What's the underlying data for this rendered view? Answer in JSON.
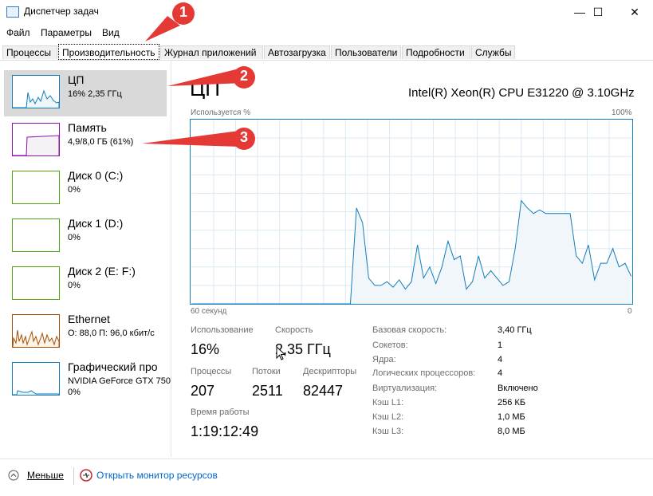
{
  "window": {
    "title": "Диспетчер задач",
    "controls": {
      "minimize": "—",
      "maximize": "☐",
      "close": "✕"
    }
  },
  "menu": [
    "Файл",
    "Параметры",
    "Вид"
  ],
  "tabs": [
    "Процессы",
    "Производительность",
    "Журнал приложений",
    "Автозагрузка",
    "Пользователи",
    "Подробности",
    "Службы"
  ],
  "active_tab": "Производительность",
  "sidebar": {
    "items": [
      {
        "name": "ЦП",
        "sub": "16% 2,35 ГГц",
        "color": "#117dbb",
        "selected": true
      },
      {
        "name": "Память",
        "sub": "4,9/8,0 ГБ (61%)",
        "color": "#8b12ae",
        "selected": false
      },
      {
        "name": "Диск 0 (C:)",
        "sub": "0%",
        "color": "#4da60c",
        "selected": false
      },
      {
        "name": "Диск 1 (D:)",
        "sub": "0%",
        "color": "#4da60c",
        "selected": false
      },
      {
        "name": "Диск 2 (E: F:)",
        "sub": "0%",
        "color": "#4da60c",
        "selected": false
      },
      {
        "name": "Ethernet",
        "sub": "О: 88,0 П: 96,0 кбит/с",
        "color": "#a74f01",
        "selected": false
      },
      {
        "name": "Графический про",
        "sub": "NVIDIA GeForce GTX 750",
        "sub2": "0%",
        "color": "#117dbb",
        "selected": false
      }
    ]
  },
  "main": {
    "title": "ЦП",
    "cpu_name": "Intel(R) Xeon(R) CPU E31220 @ 3.10GHz",
    "graph_top_left": "Используется %",
    "graph_top_right": "100%",
    "graph_bottom_left": "60 секунд",
    "graph_bottom_right": "0",
    "graph_color": "#117dbb",
    "graph_series": [
      0,
      0,
      0,
      0,
      0,
      0,
      0,
      0,
      0,
      0,
      0,
      0,
      0,
      0,
      0,
      0,
      0,
      0,
      0,
      0,
      0,
      0,
      0,
      0,
      0,
      0,
      0,
      52,
      44,
      14,
      10,
      10,
      12,
      9,
      13,
      8,
      12,
      32,
      14,
      20,
      11,
      20,
      34,
      24,
      26,
      8,
      12,
      26,
      14,
      18,
      14,
      10,
      12,
      30,
      56,
      52,
      49,
      51,
      49,
      49,
      49,
      49,
      49,
      26,
      22,
      32,
      13,
      22,
      22,
      30,
      20,
      22,
      15
    ],
    "stats": {
      "utilization_label": "Использование",
      "utilization": "16%",
      "speed_label": "Скорость",
      "speed": "2,35 ГГц",
      "processes_label": "Процессы",
      "processes": "207",
      "threads_label": "Потоки",
      "threads": "2511",
      "handles_label": "Дескрипторы",
      "handles": "82447",
      "uptime_label": "Время работы",
      "uptime": "1:19:12:49"
    },
    "details": [
      {
        "label": "Базовая скорость:",
        "value": "3,40 ГГц"
      },
      {
        "label": "Сокетов:",
        "value": "1"
      },
      {
        "label": "Ядра:",
        "value": "4"
      },
      {
        "label": "Логических процессоров:",
        "value": "4"
      },
      {
        "label": "Виртуализация:",
        "value": "Включено"
      },
      {
        "label": "Кэш L1:",
        "value": "256 КБ"
      },
      {
        "label": "Кэш L2:",
        "value": "1,0 МБ"
      },
      {
        "label": "Кэш L3:",
        "value": "8,0 МБ"
      }
    ]
  },
  "footer": {
    "fewer_details": "Меньше",
    "resource_monitor": "Открыть монитор ресурсов"
  },
  "annotations": [
    "1",
    "2",
    "3"
  ],
  "annotation_color": "#e53935"
}
